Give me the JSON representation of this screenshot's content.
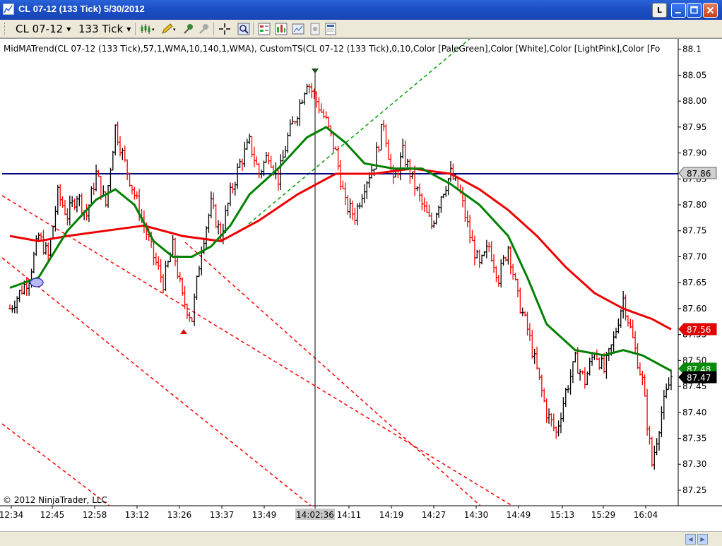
{
  "window": {
    "title": "CL 07-12 (133 Tick)  5/30/2012",
    "link_button": "L",
    "min_icon": "minimize-icon",
    "max_icon": "maximize-icon",
    "close_icon": "close-icon"
  },
  "toolbar": {
    "instrument": "CL 07-12",
    "interval": "133 Tick",
    "icons": [
      "bar-style-icon",
      "pencil-icon",
      "zoom-in-icon",
      "zoom-out-icon",
      "crosshair-icon",
      "magnifier-icon",
      "strategies-icon",
      "indicators-icon",
      "chart-properties-icon",
      "data-box-icon",
      "templates-icon"
    ]
  },
  "chart": {
    "indicator_label": "MidMATrend(CL  07-12  (133  Tick),57,1,WMA,10,140,1,WMA),  CustomTS(CL  07-12  (133  Tick),0,10,Color  [PaleGreen],Color  [White],Color  [LightPink],Color  [Fo",
    "copyright": "© 2012 NinjaTrader, LLC",
    "colors": {
      "up_bar": "#000000",
      "down_bar": "#ff0000",
      "fast_ma": "#008000",
      "slow_ma": "#ee0000",
      "horizontal_line": "#000080",
      "trend_lines": "#ff0000",
      "green_trend": "#00a000"
    }
  },
  "chart_data": {
    "type": "candlestick",
    "instrument": "CL 07-12",
    "y_ticks": [
      "88.1",
      "88.05",
      "88.00",
      "87.95",
      "87.90",
      "87.85",
      "87.80",
      "87.75",
      "87.70",
      "87.65",
      "87.60",
      "87.55",
      "87.50",
      "87.45",
      "87.40",
      "87.35",
      "87.30",
      "87.25"
    ],
    "ylim": [
      87.22,
      88.12
    ],
    "x_ticks": [
      "12:34",
      "12:45",
      "12:58",
      "13:12",
      "13:26",
      "13:37",
      "13:49",
      "14:02:36",
      "14:11",
      "14:19",
      "14:27",
      "14:30",
      "14:49",
      "15:13",
      "15:29",
      "16:04"
    ],
    "highlighted_x_tick": "14:02:36",
    "price_markers": [
      {
        "label": "87.86",
        "value": 87.86,
        "style": "gray"
      },
      {
        "label": "87.56",
        "value": 87.56,
        "style": "red"
      },
      {
        "label": "87.48",
        "value": 87.48,
        "style": "green"
      },
      {
        "label": "87.47",
        "value": 87.47,
        "style": "black"
      }
    ],
    "horizontal_line": 87.86,
    "close_path": [
      [
        0,
        87.6
      ],
      [
        8,
        87.66
      ],
      [
        12,
        87.74
      ],
      [
        16,
        87.7
      ],
      [
        20,
        87.82
      ],
      [
        24,
        87.78
      ],
      [
        28,
        87.82
      ],
      [
        32,
        87.78
      ],
      [
        36,
        87.86
      ],
      [
        40,
        87.8
      ],
      [
        44,
        87.95
      ],
      [
        48,
        87.88
      ],
      [
        52,
        87.82
      ],
      [
        56,
        87.76
      ],
      [
        60,
        87.7
      ],
      [
        64,
        87.65
      ],
      [
        68,
        87.72
      ],
      [
        72,
        87.62
      ],
      [
        76,
        87.58
      ],
      [
        80,
        87.72
      ],
      [
        84,
        87.8
      ],
      [
        88,
        87.74
      ],
      [
        92,
        87.82
      ],
      [
        96,
        87.88
      ],
      [
        100,
        87.92
      ],
      [
        104,
        87.86
      ],
      [
        108,
        87.9
      ],
      [
        112,
        87.85
      ],
      [
        116,
        87.93
      ],
      [
        120,
        87.98
      ],
      [
        124,
        88.04
      ],
      [
        128,
        88.0
      ],
      [
        132,
        87.96
      ],
      [
        136,
        87.9
      ],
      [
        140,
        87.8
      ],
      [
        144,
        87.78
      ],
      [
        148,
        87.84
      ],
      [
        152,
        87.88
      ],
      [
        156,
        87.96
      ],
      [
        160,
        87.84
      ],
      [
        164,
        87.9
      ],
      [
        168,
        87.85
      ],
      [
        172,
        87.8
      ],
      [
        176,
        87.76
      ],
      [
        180,
        87.82
      ],
      [
        184,
        87.86
      ],
      [
        188,
        87.82
      ],
      [
        192,
        87.74
      ],
      [
        196,
        87.68
      ],
      [
        200,
        87.72
      ],
      [
        204,
        87.66
      ],
      [
        208,
        87.72
      ],
      [
        212,
        87.62
      ],
      [
        216,
        87.56
      ],
      [
        220,
        87.48
      ],
      [
        224,
        87.4
      ],
      [
        228,
        87.36
      ],
      [
        232,
        87.44
      ],
      [
        236,
        87.5
      ],
      [
        240,
        87.46
      ],
      [
        244,
        87.52
      ],
      [
        248,
        87.48
      ],
      [
        252,
        87.54
      ],
      [
        256,
        87.62
      ],
      [
        260,
        87.54
      ],
      [
        264,
        87.46
      ],
      [
        268,
        87.3
      ],
      [
        272,
        87.4
      ],
      [
        276,
        87.47
      ]
    ],
    "fast_ma": [
      [
        0,
        87.64
      ],
      [
        12,
        87.66
      ],
      [
        24,
        87.75
      ],
      [
        36,
        87.81
      ],
      [
        44,
        87.83
      ],
      [
        52,
        87.8
      ],
      [
        60,
        87.73
      ],
      [
        68,
        87.7
      ],
      [
        76,
        87.7
      ],
      [
        84,
        87.72
      ],
      [
        92,
        87.76
      ],
      [
        100,
        87.82
      ],
      [
        112,
        87.87
      ],
      [
        124,
        87.93
      ],
      [
        132,
        87.95
      ],
      [
        140,
        87.92
      ],
      [
        148,
        87.88
      ],
      [
        160,
        87.87
      ],
      [
        172,
        87.87
      ],
      [
        184,
        87.84
      ],
      [
        196,
        87.8
      ],
      [
        208,
        87.74
      ],
      [
        216,
        87.66
      ],
      [
        224,
        87.57
      ],
      [
        236,
        87.52
      ],
      [
        248,
        87.51
      ],
      [
        256,
        87.52
      ],
      [
        264,
        87.51
      ],
      [
        276,
        87.48
      ]
    ],
    "slow_ma": [
      [
        0,
        87.74
      ],
      [
        12,
        87.73
      ],
      [
        24,
        87.74
      ],
      [
        40,
        87.75
      ],
      [
        56,
        87.76
      ],
      [
        72,
        87.74
      ],
      [
        88,
        87.73
      ],
      [
        104,
        87.77
      ],
      [
        120,
        87.82
      ],
      [
        136,
        87.86
      ],
      [
        152,
        87.86
      ],
      [
        168,
        87.87
      ],
      [
        184,
        87.86
      ],
      [
        196,
        87.83
      ],
      [
        208,
        87.79
      ],
      [
        220,
        87.74
      ],
      [
        232,
        87.68
      ],
      [
        244,
        87.63
      ],
      [
        256,
        87.6
      ],
      [
        268,
        87.58
      ],
      [
        276,
        87.56
      ]
    ]
  }
}
